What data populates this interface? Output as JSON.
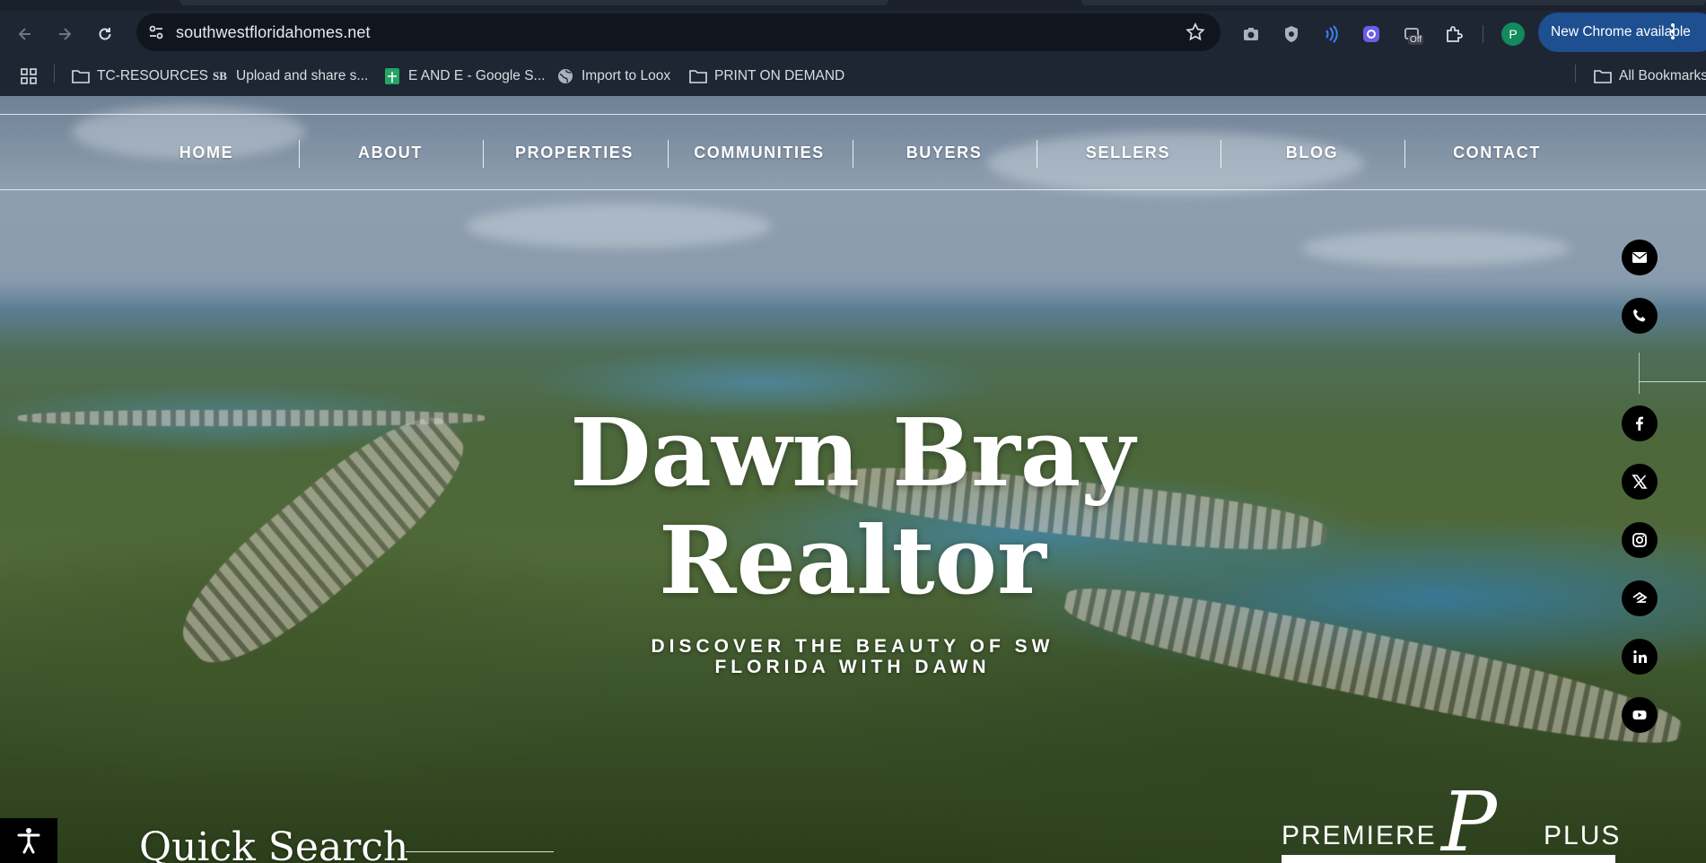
{
  "browser": {
    "url": "southwestfloridahomes.net",
    "update_chip": "New Chrome available",
    "profile_initial": "P",
    "extension_badge": "Off",
    "bookmarks": [
      {
        "label": "TC-RESOURCES",
        "icon": "folder-icon"
      },
      {
        "label": "Upload and share s...",
        "icon": "sb-logo-icon"
      },
      {
        "label": "E AND E - Google S...",
        "icon": "google-sheets-icon"
      },
      {
        "label": "Import to Loox",
        "icon": "globe-icon"
      },
      {
        "label": "PRINT ON DEMAND",
        "icon": "folder-icon"
      }
    ],
    "all_bookmarks": "All Bookmarks"
  },
  "site": {
    "nav": [
      "HOME",
      "ABOUT",
      "PROPERTIES",
      "COMMUNITIES",
      "BUYERS",
      "SELLERS",
      "BLOG",
      "CONTACT"
    ],
    "hero": {
      "title_line1": "Dawn Bray",
      "title_line2": "Realtor",
      "subtitle_line1": "DISCOVER THE BEAUTY OF SW",
      "subtitle_line2": "FLORIDA WITH DAWN"
    },
    "social": [
      "email-icon",
      "phone-icon",
      "facebook-icon",
      "x-twitter-icon",
      "instagram-icon",
      "zillow-icon",
      "linkedin-icon",
      "youtube-icon"
    ],
    "quick_search": "Quick Search",
    "brand": {
      "left": "PREMIERE",
      "monogram": "P",
      "right": "PLUS"
    }
  }
}
